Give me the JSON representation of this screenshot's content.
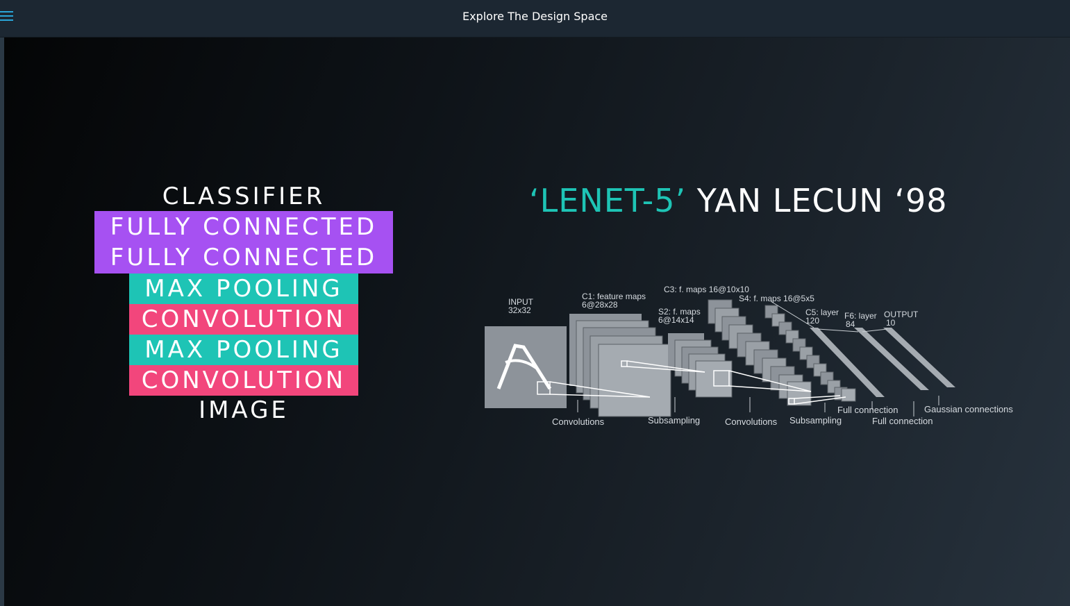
{
  "topbar": {
    "title": "Explore The Design Space",
    "menu_icon": "hamburger-icon",
    "accent_color": "#2aa6d9"
  },
  "slide": {
    "stack": {
      "classifier": "CLASSIFIER",
      "fully_connected_1": "FULLY CONNECTED",
      "fully_connected_2": "FULLY CONNECTED",
      "max_pooling_1": "MAX POOLING",
      "convolution_1": "CONVOLUTION",
      "max_pooling_2": "MAX POOLING",
      "convolution_2": "CONVOLUTION",
      "image": "IMAGE",
      "colors": {
        "fully_connected": "#a651f2",
        "pooling": "#1ec4b5",
        "convolution": "#f2467c"
      }
    },
    "lenet": {
      "title_teal": "‘LENET-5’",
      "title_rest": " YAN LECUN ‘98",
      "labels": {
        "input": "INPUT",
        "input_size": "32x32",
        "c1": "C1: feature maps",
        "c1_size": "6@28x28",
        "s2": "S2: f. maps",
        "s2_size": "6@14x14",
        "c3": "C3: f. maps 16@10x10",
        "s4": "S4: f. maps 16@5x5",
        "c5": "C5: layer",
        "c5_size": "120",
        "f6": "F6: layer",
        "f6_size": "84",
        "output": "OUTPUT",
        "output_size": "10"
      },
      "bottom_labels": {
        "convolutions_1": "Convolutions",
        "subsampling_1": "Subsampling",
        "convolutions_2": "Convolutions",
        "subsampling_2": "Subsampling",
        "full_connection_1": "Full connection",
        "full_connection_2": "Full connection",
        "gaussian": "Gaussian connections"
      }
    }
  }
}
